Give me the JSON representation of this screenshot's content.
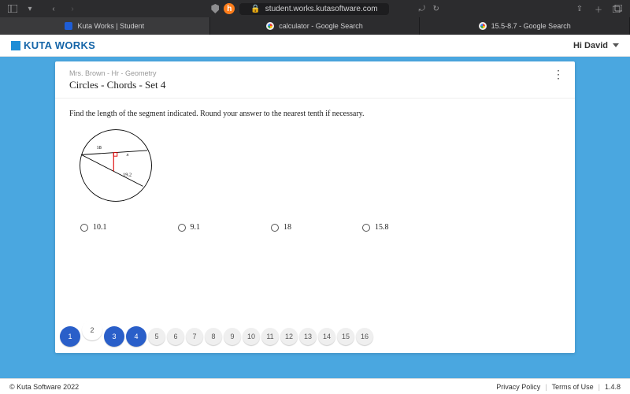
{
  "browser": {
    "url": "student.works.kutasoftware.com",
    "tabs": [
      {
        "label": "Kuta Works | Student",
        "active": true,
        "favicon": "kuta"
      },
      {
        "label": "calculator - Google Search",
        "active": false,
        "favicon": "google"
      },
      {
        "label": "15.5-8.7 - Google Search",
        "active": false,
        "favicon": "google"
      }
    ]
  },
  "header": {
    "brand": "KUTA WORKS",
    "user_greeting": "Hi David"
  },
  "assignment": {
    "breadcrumb": "Mrs. Brown - Hr - Geometry",
    "title": "Circles - Chords - Set 4",
    "prompt": "Find the length of the segment indicated.  Round your answer to the nearest tenth if necessary.",
    "figure": {
      "chord1": "18",
      "chord2": "19.2",
      "unknown": "x"
    },
    "choices": [
      "10.1",
      "9.1",
      "18",
      "15.8"
    ]
  },
  "pager": {
    "items": [
      "1",
      "2",
      "3",
      "4",
      "5",
      "6",
      "7",
      "8",
      "9",
      "10",
      "11",
      "12",
      "13",
      "14",
      "15",
      "16"
    ],
    "accent": "#2a5fc9",
    "active": [
      "1",
      "3",
      "4"
    ],
    "raised": "2"
  },
  "footer": {
    "copyright": "© Kuta Software 2022",
    "privacy": "Privacy Policy",
    "terms": "Terms of Use",
    "version": "1.4.8"
  }
}
